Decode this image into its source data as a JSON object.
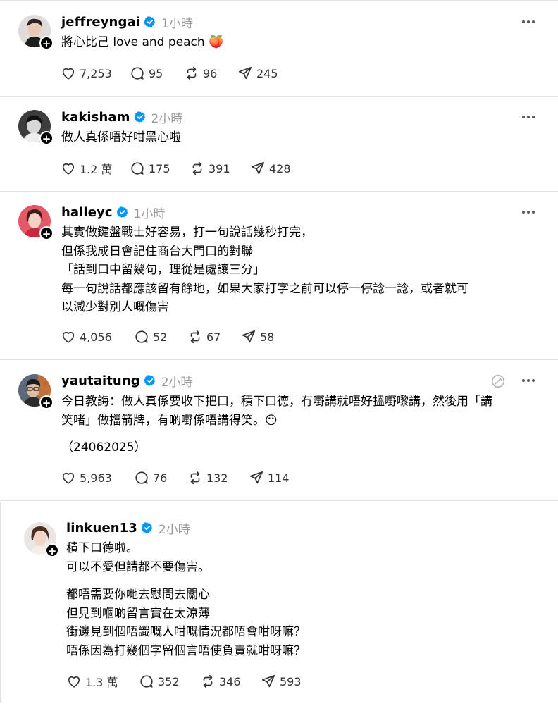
{
  "posts": [
    {
      "username": "jeffreyngai",
      "time": "1小時",
      "text": "將心比己 love and peach 🍑",
      "likes": "7,253",
      "replies": "95",
      "reposts": "96",
      "shares": "245"
    },
    {
      "username": "kakisham",
      "time": "2小時",
      "text": "做人真係唔好咁黑心啦",
      "likes": "1.2 萬",
      "replies": "175",
      "reposts": "391",
      "shares": "428"
    },
    {
      "username": "haileyc",
      "time": "1小時",
      "text": "其實做鍵盤戰士好容易，打一句說話幾秒打完，\n但係我成日會記住商台大門口的對聯\n「話到口中留幾句，理從是處讓三分」\n每一句說話都應該留有餘地，如果大家打字之前可以停一停諗一諗，或者就可\n以減少對別人嘅傷害",
      "likes": "4,056",
      "replies": "52",
      "reposts": "67",
      "shares": "58"
    },
    {
      "username": "yautaitung",
      "time": "2小時",
      "text": "今日教誨：做人真係要收下把口，積下口德，冇嘢講就唔好搵嘢嚟講，然後用「講\n笑啫」做擋箭牌，有啲嘢係唔講得笑。😶",
      "text2": "（24062025）",
      "likes": "5,963",
      "replies": "76",
      "reposts": "132",
      "shares": "114"
    },
    {
      "username": "linkuen13",
      "time": "2小時",
      "text": "積下口德啦。\n可以不愛但請都不要傷害。",
      "text2": "都唔需要你哋去慰問去關心\n但見到嗰啲留言實在太涼薄\n街邊見到個唔識嘅人咁嘅情況都唔會咁呀嘛？\n唔係因為打幾個字留個言唔使負責就咁呀嘛？",
      "likes": "1.3 萬",
      "replies": "352",
      "reposts": "346",
      "shares": "593"
    }
  ],
  "colors": {
    "verified": "#0095f6",
    "muted": "#999999",
    "icon": "#333333"
  }
}
